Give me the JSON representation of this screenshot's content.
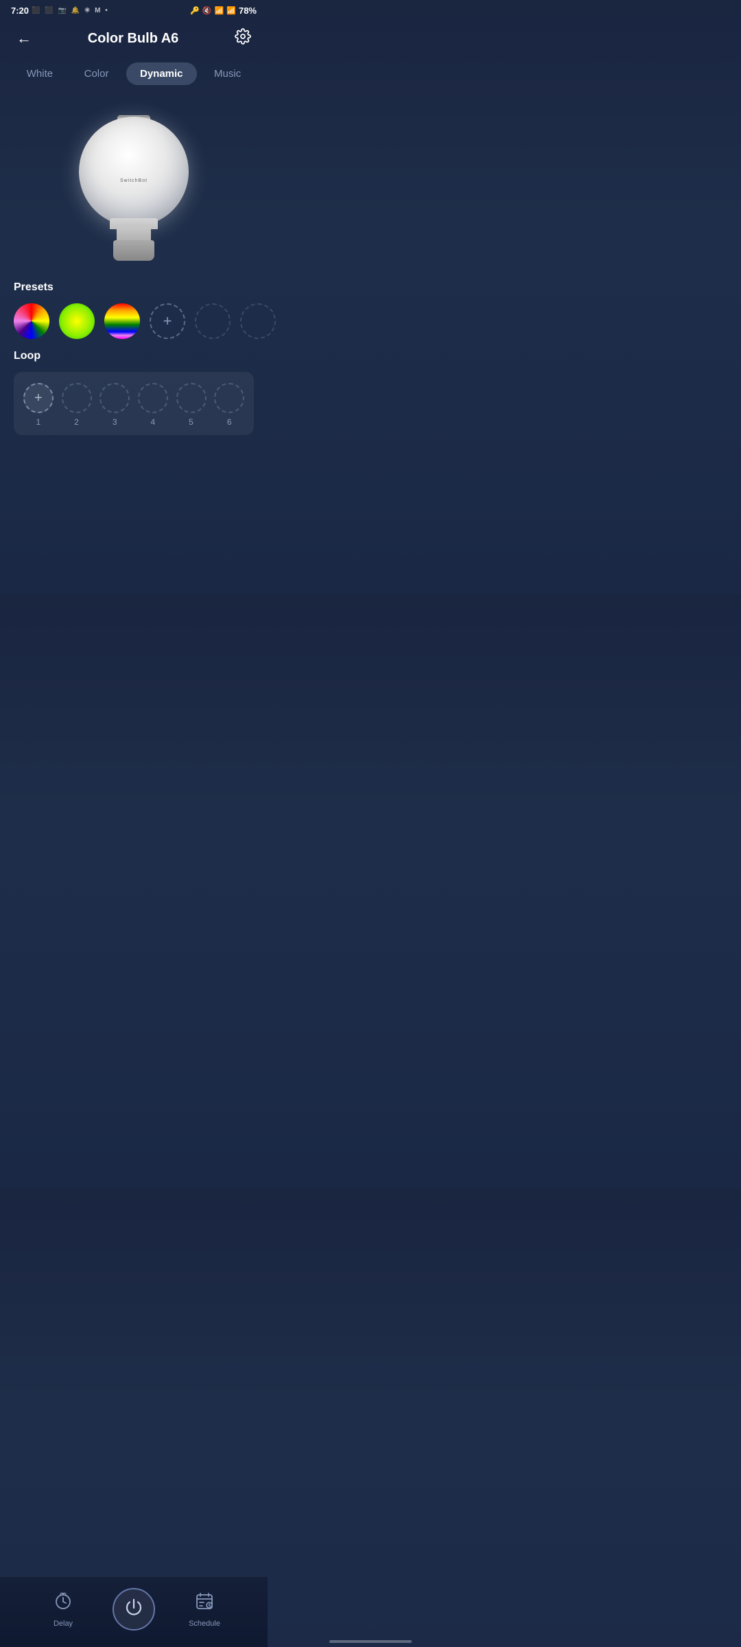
{
  "statusBar": {
    "time": "7:20",
    "battery": "78%"
  },
  "header": {
    "title": "Color Bulb A6",
    "backLabel": "‹",
    "settingsLabel": "⚙"
  },
  "tabs": [
    {
      "id": "white",
      "label": "White",
      "active": false
    },
    {
      "id": "color",
      "label": "Color",
      "active": false
    },
    {
      "id": "dynamic",
      "label": "Dynamic",
      "active": true
    },
    {
      "id": "music",
      "label": "Music",
      "active": false
    }
  ],
  "bulb": {
    "brand": "SwitchBot"
  },
  "presets": {
    "title": "Presets",
    "addLabel": "+",
    "items": [
      {
        "id": 1,
        "type": "rainbow1",
        "label": "Rainbow"
      },
      {
        "id": 2,
        "type": "yellow-green",
        "label": "Lime"
      },
      {
        "id": 3,
        "type": "rainbow2",
        "label": "Colorful"
      }
    ],
    "emptyCount": 2
  },
  "loop": {
    "title": "Loop",
    "addLabel": "+",
    "slots": [
      {
        "id": 1,
        "label": "1",
        "type": "add"
      },
      {
        "id": 2,
        "label": "2",
        "type": "empty"
      },
      {
        "id": 3,
        "label": "3",
        "type": "empty"
      },
      {
        "id": 4,
        "label": "4",
        "type": "empty"
      },
      {
        "id": 5,
        "label": "5",
        "type": "empty"
      },
      {
        "id": 6,
        "label": "6",
        "type": "empty"
      }
    ]
  },
  "bottomNav": {
    "delay": {
      "label": "Delay",
      "icon": "⏱"
    },
    "power": {
      "icon": "⏻"
    },
    "schedule": {
      "label": "Schedule",
      "icon": "📅"
    }
  }
}
